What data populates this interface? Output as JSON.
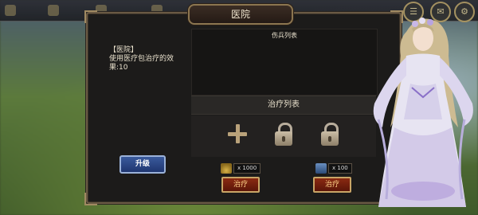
{
  "dialog": {
    "title": "医院"
  },
  "info": {
    "name": "【医院】",
    "line1": "使用医疗包治疗的效",
    "line2": "果:10"
  },
  "upgrade_label": "升级",
  "wounded_list_title": "伤兵列表",
  "heal_list_title": "治疗列表",
  "heal_options": [
    {
      "cost": "x 1000",
      "icon": "gold-icon",
      "button": "治疗"
    },
    {
      "cost": "x 100",
      "icon": "medkit-icon",
      "button": "治疗"
    }
  ],
  "slots": [
    "plus-icon",
    "lock-icon",
    "lock-icon"
  ]
}
